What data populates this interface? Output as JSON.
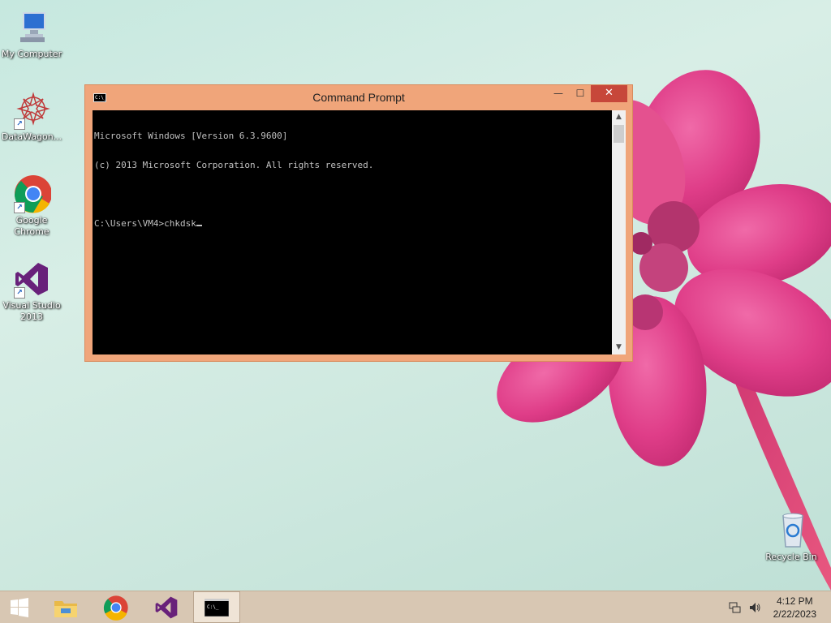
{
  "desktop": {
    "icons": [
      {
        "label": "My Computer",
        "icon": "computer-icon"
      },
      {
        "label": "DataWagon...",
        "icon": "datawagon-icon"
      },
      {
        "label": "Google Chrome",
        "icon": "chrome-icon"
      },
      {
        "label": "Visual Studio 2013",
        "icon": "visual-studio-icon"
      },
      {
        "label": "Recycle Bin",
        "icon": "recycle-bin-icon"
      }
    ]
  },
  "window": {
    "title": "Command Prompt",
    "icon_text": "C:\\_",
    "minimize_label": "—",
    "maximize_label": "☐",
    "close_label": "✕",
    "console_lines": [
      "Microsoft Windows [Version 6.3.9600]",
      "(c) 2013 Microsoft Corporation. All rights reserved.",
      "",
      "C:\\Users\\VM4>chkdsk"
    ]
  },
  "taskbar": {
    "items": [
      {
        "name": "start-button",
        "icon": "windows-logo-icon"
      },
      {
        "name": "file-explorer",
        "icon": "folder-icon"
      },
      {
        "name": "chrome",
        "icon": "chrome-icon"
      },
      {
        "name": "visual-studio",
        "icon": "visual-studio-icon"
      },
      {
        "name": "command-prompt",
        "icon": "cmd-icon",
        "active": true
      }
    ],
    "time": "4:12 PM",
    "date": "2/22/2023"
  }
}
